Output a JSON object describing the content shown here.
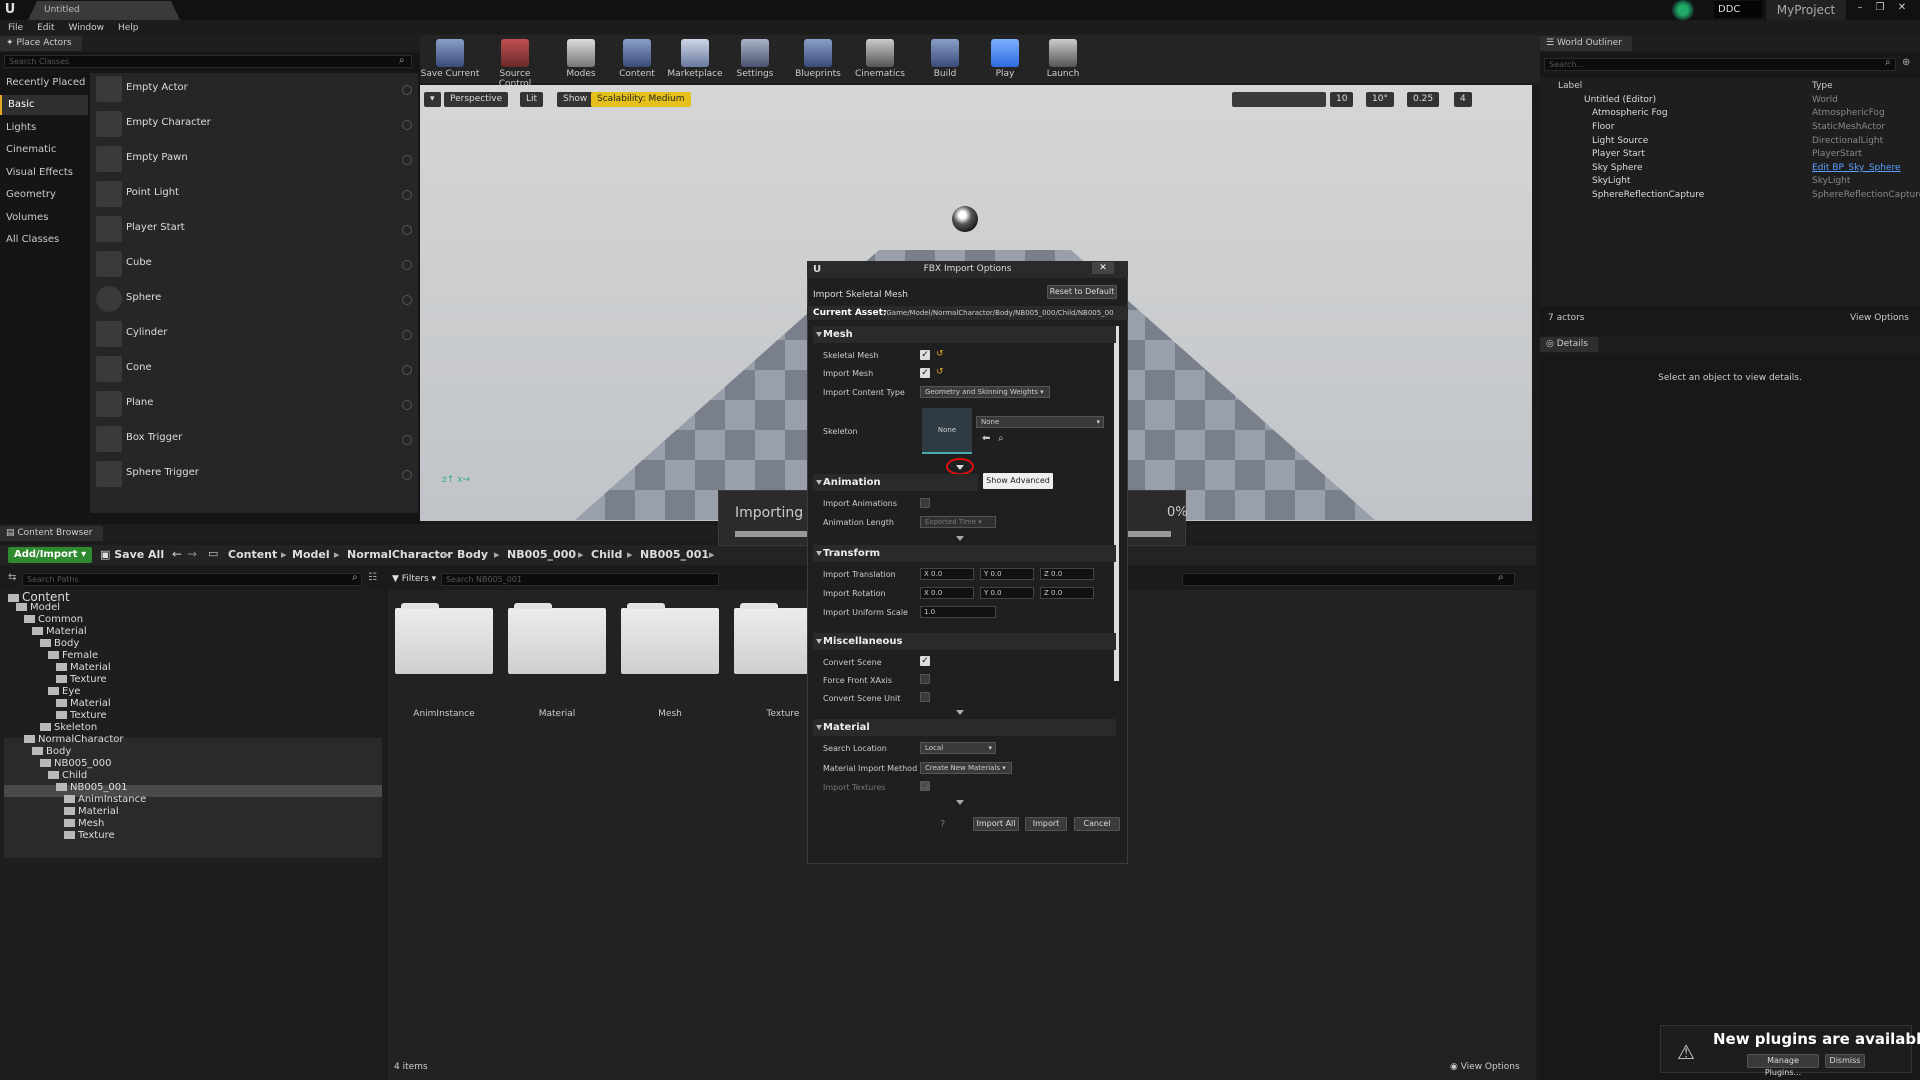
{
  "window": {
    "tab": "Untitled",
    "ddc": "DDC",
    "project": "MyProject"
  },
  "menu": [
    "File",
    "Edit",
    "Window",
    "Help"
  ],
  "place_actors": {
    "tab": "Place Actors",
    "search_placeholder": "Search Classes",
    "categories": [
      "Recently Placed",
      "Basic",
      "Lights",
      "Cinematic",
      "Visual Effects",
      "Geometry",
      "Volumes",
      "All Classes"
    ],
    "actors": [
      "Empty Actor",
      "Empty Character",
      "Empty Pawn",
      "Point Light",
      "Player Start",
      "Cube",
      "Sphere",
      "Cylinder",
      "Cone",
      "Plane",
      "Box Trigger",
      "Sphere Trigger"
    ]
  },
  "toolbar": [
    "Save Current",
    "Source Control",
    "Modes",
    "Content",
    "Marketplace",
    "Settings",
    "Blueprints",
    "Cinematics",
    "Build",
    "Play",
    "Launch"
  ],
  "viewport": {
    "perspective": "Perspective",
    "lit": "Lit",
    "show": "Show",
    "scalability": "Scalability: Medium",
    "grid": "10",
    "rot": "10°",
    "scale": "0.25",
    "cam": "4"
  },
  "outliner": {
    "tab": "World Outliner",
    "search_placeholder": "Search...",
    "col_label": "Label",
    "col_type": "Type",
    "rows": [
      {
        "name": "Untitled (Editor)",
        "type": "World"
      },
      {
        "name": "Atmospheric Fog",
        "type": "AtmosphericFog"
      },
      {
        "name": "Floor",
        "type": "StaticMeshActor"
      },
      {
        "name": "Light Source",
        "type": "DirectionalLight"
      },
      {
        "name": "Player Start",
        "type": "PlayerStart"
      },
      {
        "name": "Sky Sphere",
        "type": "Edit BP_Sky_Sphere"
      },
      {
        "name": "SkyLight",
        "type": "SkyLight"
      },
      {
        "name": "SphereReflectionCapture",
        "type": "SphereReflectionCapture"
      }
    ],
    "count": "7 actors",
    "view_options": "View Options"
  },
  "details": {
    "tab": "Details",
    "empty": "Select an object to view details."
  },
  "content_browser": {
    "tab": "Content Browser",
    "add_import": "Add/Import",
    "save_all": "Save All",
    "breadcrumbs": [
      "Content",
      "Model",
      "NormalCharactor",
      "Body",
      "NB005_000",
      "Child",
      "NB005_001"
    ],
    "search_paths_placeholder": "Search Paths",
    "filters": "Filters",
    "search_placeholder": "Search NB005_001",
    "tree": [
      {
        "name": "Content",
        "depth": 0
      },
      {
        "name": "Model",
        "depth": 1
      },
      {
        "name": "Common",
        "depth": 2
      },
      {
        "name": "Material",
        "depth": 3
      },
      {
        "name": "Body",
        "depth": 4
      },
      {
        "name": "Female",
        "depth": 5
      },
      {
        "name": "Material",
        "depth": 6
      },
      {
        "name": "Texture",
        "depth": 6
      },
      {
        "name": "Eye",
        "depth": 5
      },
      {
        "name": "Material",
        "depth": 6
      },
      {
        "name": "Texture",
        "depth": 6
      },
      {
        "name": "Skeleton",
        "depth": 4
      },
      {
        "name": "NormalCharactor",
        "depth": 2
      },
      {
        "name": "Body",
        "depth": 3
      },
      {
        "name": "NB005_000",
        "depth": 4
      },
      {
        "name": "Child",
        "depth": 5
      },
      {
        "name": "NB005_001",
        "depth": 6
      },
      {
        "name": "AnimInstance",
        "depth": 7
      },
      {
        "name": "Material",
        "depth": 7
      },
      {
        "name": "Mesh",
        "depth": 7
      },
      {
        "name": "Texture",
        "depth": 7
      }
    ],
    "folders": [
      "AnimInstance",
      "Material",
      "Mesh",
      "Texture"
    ],
    "item_count": "4 items",
    "view_options": "View Options"
  },
  "importing": {
    "label": "Importing \"S",
    "percent": "0%"
  },
  "fbx": {
    "title": "FBX Import Options",
    "subtitle": "Import Skeletal Mesh",
    "reset": "Reset to Default",
    "current_asset_label": "Current Asset:",
    "current_asset": "/Game/Model/NormalCharactor/Body/NB005_000/Child/NB005_00",
    "mesh": "Mesh",
    "skeletal_mesh": "Skeletal Mesh",
    "import_mesh": "Import Mesh",
    "import_content_type": "Import Content Type",
    "content_type_value": "Geometry and Skinning Weights",
    "skeleton": "Skeleton",
    "skeleton_thumb": "None",
    "skeleton_value": "None",
    "show_advanced": "Show Advanced",
    "animation": "Animation",
    "import_animations": "Import Animations",
    "animation_length": "Animation Length",
    "anim_length_value": "Exported Time",
    "transform": "Transform",
    "import_translation": "Import Translation",
    "import_rotation": "Import Rotation",
    "import_uniform_scale": "Import Uniform Scale",
    "tx": "X 0.0",
    "ty": "Y 0.0",
    "tz": "Z 0.0",
    "rx": "X 0.0",
    "ry": "Y 0.0",
    "rz": "Z 0.0",
    "scale": "1.0",
    "misc": "Miscellaneous",
    "convert_scene": "Convert Scene",
    "force_front": "Force Front XAxis",
    "convert_unit": "Convert Scene Unit",
    "material": "Material",
    "search_location": "Search Location",
    "search_location_value": "Local",
    "material_import_method": "Material Import Method",
    "material_method_value": "Create New Materials",
    "import_textures": "Import Textures",
    "import_all": "Import All",
    "import": "Import",
    "cancel": "Cancel"
  },
  "notification": {
    "title": "New plugins are available",
    "manage": "Manage Plugins...",
    "dismiss": "Dismiss"
  }
}
